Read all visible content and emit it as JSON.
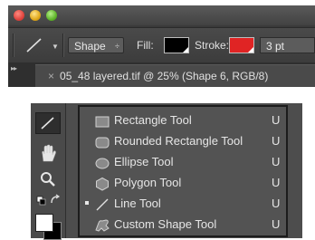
{
  "options_bar": {
    "tool_mode": "Shape",
    "fill_label": "Fill:",
    "stroke_label": "Stroke:",
    "stroke_width": "3 pt",
    "fill_color": "#000000",
    "stroke_color": "#e02424"
  },
  "document_tab": {
    "close_glyph": "×",
    "title": "05_48 layered.tif @ 25% (Shape 6, RGB/8)"
  },
  "flyout": {
    "items": [
      {
        "label": "Rectangle Tool",
        "shortcut": "U",
        "icon": "rectangle-icon",
        "selected": false
      },
      {
        "label": "Rounded Rectangle Tool",
        "shortcut": "U",
        "icon": "rounded-rectangle-icon",
        "selected": false
      },
      {
        "label": "Ellipse Tool",
        "shortcut": "U",
        "icon": "ellipse-icon",
        "selected": false
      },
      {
        "label": "Polygon Tool",
        "shortcut": "U",
        "icon": "polygon-icon",
        "selected": false
      },
      {
        "label": "Line Tool",
        "shortcut": "U",
        "icon": "line-icon",
        "selected": true
      },
      {
        "label": "Custom Shape Tool",
        "shortcut": "U",
        "icon": "custom-shape-icon",
        "selected": false
      }
    ]
  },
  "toolbox": {
    "tools": [
      "line-tool-icon",
      "hand-icon",
      "zoom-icon",
      "swap-colors-icon"
    ],
    "foreground_color": "#ffffff",
    "background_color": "#000000"
  }
}
